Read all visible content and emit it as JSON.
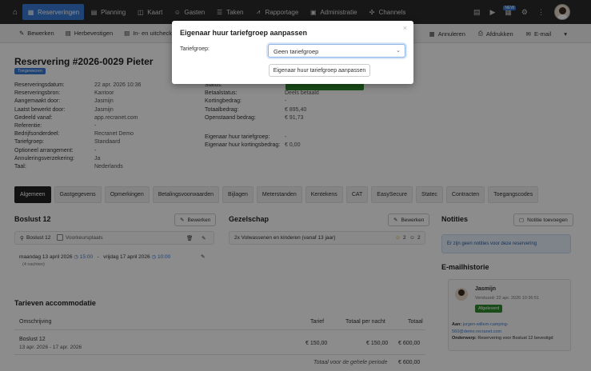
{
  "nav": {
    "items": [
      {
        "label": "Reserveringen",
        "icon": "▦",
        "active": true
      },
      {
        "label": "Planning",
        "icon": "▤"
      },
      {
        "label": "Kaart",
        "icon": "◫"
      },
      {
        "label": "Gasten",
        "icon": "☺"
      },
      {
        "label": "Taken",
        "icon": "☰"
      },
      {
        "label": "Rapportage",
        "icon": "⩘"
      },
      {
        "label": "Administratie",
        "icon": "▣"
      },
      {
        "label": "Channels",
        "icon": "✣"
      }
    ],
    "new_badge": "NEW"
  },
  "toolbar": {
    "left": [
      {
        "label": "Bewerken",
        "icon": "✎"
      },
      {
        "label": "Herbevestigen",
        "icon": "▤"
      },
      {
        "label": "In- en uitchecke",
        "icon": "▤"
      }
    ],
    "right": [
      {
        "label": "Annuleren",
        "icon": "▦"
      },
      {
        "label": "Afdrukken",
        "icon": "⎙"
      },
      {
        "label": "E-mail",
        "icon": "✉"
      }
    ]
  },
  "reservation": {
    "title": "Reservering #2026-0029 Pieter",
    "badge": "Toegewezen",
    "left_fields": [
      {
        "k": "Reserveringsdatum:",
        "v": "22 apr. 2026 10:36"
      },
      {
        "k": "Reserveringsbron:",
        "v": "Kantoor"
      },
      {
        "k": "Aangemaakt door:",
        "v": "Jasmijn"
      },
      {
        "k": "Laatst bewerkt door:",
        "v": "Jasmijn"
      },
      {
        "k": "Gedeeld vanaf:",
        "v": "app.recranet.com"
      },
      {
        "k": "Referentie:",
        "v": "-"
      },
      {
        "k": "Bedrijfsonderdeel:",
        "v": "Recranet Demo"
      },
      {
        "k": "Tariefgroep:",
        "v": "Standaard"
      },
      {
        "k": "Optioneel arrangement:",
        "v": "-"
      },
      {
        "k": "Annuleringsverzekering:",
        "v": "Ja"
      },
      {
        "k": "Taal:",
        "v": "Nederlands"
      }
    ],
    "right_fields": [
      {
        "k": "Status:",
        "v": ""
      },
      {
        "k": "Betaalstatus:",
        "v": "Deels betaald"
      },
      {
        "k": "Kortingbedrag:",
        "v": "-"
      },
      {
        "k": "Totaalbedrag:",
        "v": "€ 895,40"
      },
      {
        "k": "Openstaand bedrag:",
        "v": "€ 91,73"
      }
    ],
    "right_fields2": [
      {
        "k": "Eigenaar huur tariefgroep:",
        "v": "-"
      },
      {
        "k": "Eigenaar huur kortingsbedrag:",
        "v": "€ 0,00"
      }
    ]
  },
  "tabs": [
    {
      "label": "Algemeen",
      "active": true
    },
    {
      "label": "Gastgegevens"
    },
    {
      "label": "Opmerkingen"
    },
    {
      "label": "Betalingsvoorwaarden"
    },
    {
      "label": "Bijlagen"
    },
    {
      "label": "Meterstanden"
    },
    {
      "label": "Kentekens"
    },
    {
      "label": "CAT"
    },
    {
      "label": "EasySecure"
    },
    {
      "label": "Statec"
    },
    {
      "label": "Contracten"
    },
    {
      "label": "Toegangscodes"
    }
  ],
  "booking": {
    "title": "Boslust 12",
    "edit": "Bewerken",
    "item": "Boslust 12",
    "fixed": "Voorkeursplaats",
    "date_from": "maandag 13 april 2026",
    "time_from": "15:00",
    "sep": "-",
    "date_to": "vrijdag 17 april 2026",
    "time_to": "10:00",
    "nights": "(4 nachten)"
  },
  "company": {
    "title": "Gezelschap",
    "edit": "Bewerken",
    "desc": "2x Volwassenen en kinderen (vanaf 13 jaar)",
    "count1": "2",
    "count2": "2"
  },
  "notes": {
    "title": "Notities",
    "add": "Notitie toevoegen",
    "empty": "Er zijn geen notities voor deze reservering"
  },
  "mail": {
    "title": "E-mailhistorie",
    "sender": "Jasmijn",
    "sent": "Verstuurd: 22 apr. 2026 10:36:51",
    "status": "Afgeleverd",
    "to_label": "Aan:",
    "to": "jurgen-willem-camping-",
    "to2": "560@demo.recranet.com",
    "subject_label": "Onderwerp:",
    "subject": "Reservering voor Boslust 12 bevestigd"
  },
  "rates": {
    "title": "Tarieven accommodatie",
    "col_desc": "Omschrijving",
    "col_rate": "Tarief",
    "col_total_night": "Totaal per nacht",
    "col_total": "Totaal",
    "row_title": "Boslust 12",
    "row_dates": "13 apr. 2026 - 17 apr. 2026",
    "row_rate": "€ 150,00",
    "row_night": "€ 150,00",
    "row_total": "€ 600,00",
    "footer_label": "Totaal voor de gehele periode",
    "footer_total": "€ 600,00"
  },
  "modal": {
    "title": "Eigenaar huur tariefgroep aanpassen",
    "close": "×",
    "label": "Tariefgroep:",
    "selected": "Geen tariefgroep",
    "button": "Eigenaar huur tariefgroep aanpassen"
  }
}
